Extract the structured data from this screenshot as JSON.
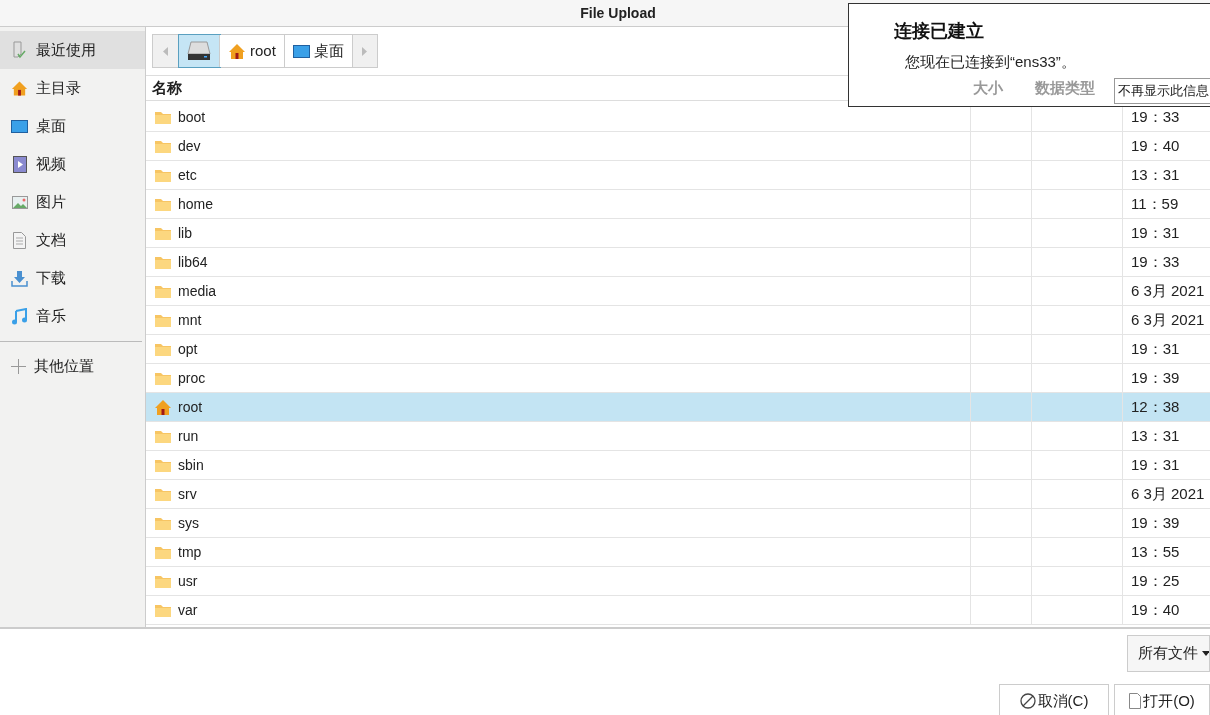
{
  "window": {
    "title": "File Upload"
  },
  "sidebar": {
    "items": [
      {
        "label": "最近使用",
        "kind": "recent",
        "selected": true
      },
      {
        "label": "主目录",
        "kind": "home",
        "selected": false
      },
      {
        "label": "桌面",
        "kind": "desktop",
        "selected": false
      },
      {
        "label": "视频",
        "kind": "video",
        "selected": false
      },
      {
        "label": "图片",
        "kind": "picture",
        "selected": false
      },
      {
        "label": "文档",
        "kind": "document",
        "selected": false
      },
      {
        "label": "下载",
        "kind": "download",
        "selected": false
      },
      {
        "label": "音乐",
        "kind": "music",
        "selected": false
      }
    ],
    "other": {
      "label": "其他位置"
    }
  },
  "path_bar": {
    "segments": [
      {
        "kind": "drive",
        "selected": true
      },
      {
        "kind": "home",
        "label": "root",
        "selected": false
      },
      {
        "kind": "desktop",
        "label": "桌面",
        "selected": false
      }
    ]
  },
  "table": {
    "columns": [
      "名称",
      "大小",
      "数据类型"
    ],
    "rows": [
      {
        "name": "boot",
        "kind": "folder",
        "modified": "19：33",
        "selected": false
      },
      {
        "name": "dev",
        "kind": "folder",
        "modified": "19：40",
        "selected": false
      },
      {
        "name": "etc",
        "kind": "folder",
        "modified": "13：31",
        "selected": false
      },
      {
        "name": "home",
        "kind": "folder",
        "modified": "11：59",
        "selected": false
      },
      {
        "name": "lib",
        "kind": "folder",
        "modified": "19：31",
        "selected": false
      },
      {
        "name": "lib64",
        "kind": "folder",
        "modified": "19：33",
        "selected": false
      },
      {
        "name": "media",
        "kind": "folder",
        "modified": "6 3月 2021",
        "selected": false
      },
      {
        "name": "mnt",
        "kind": "folder",
        "modified": "6 3月 2021",
        "selected": false
      },
      {
        "name": "opt",
        "kind": "folder",
        "modified": "19：31",
        "selected": false
      },
      {
        "name": "proc",
        "kind": "folder",
        "modified": "19：39",
        "selected": false
      },
      {
        "name": "root",
        "kind": "home",
        "modified": "12：38",
        "selected": true
      },
      {
        "name": "run",
        "kind": "folder",
        "modified": "13：31",
        "selected": false
      },
      {
        "name": "sbin",
        "kind": "folder",
        "modified": "19：31",
        "selected": false
      },
      {
        "name": "srv",
        "kind": "folder",
        "modified": "6 3月 2021",
        "selected": false
      },
      {
        "name": "sys",
        "kind": "folder",
        "modified": "19：39",
        "selected": false
      },
      {
        "name": "tmp",
        "kind": "folder",
        "modified": "13：55",
        "selected": false
      },
      {
        "name": "usr",
        "kind": "folder",
        "modified": "19：25",
        "selected": false
      },
      {
        "name": "var",
        "kind": "folder",
        "modified": "19：40",
        "selected": false
      }
    ]
  },
  "filter": {
    "value": "所有文件"
  },
  "buttons": [
    {
      "kind": "cancel",
      "label": "取消(C)"
    },
    {
      "kind": "open",
      "label": "打开(O)"
    }
  ],
  "notification": {
    "title": "连接已建立",
    "message": "您现在已连接到“ens33”。",
    "button": "不再显示此信息"
  }
}
